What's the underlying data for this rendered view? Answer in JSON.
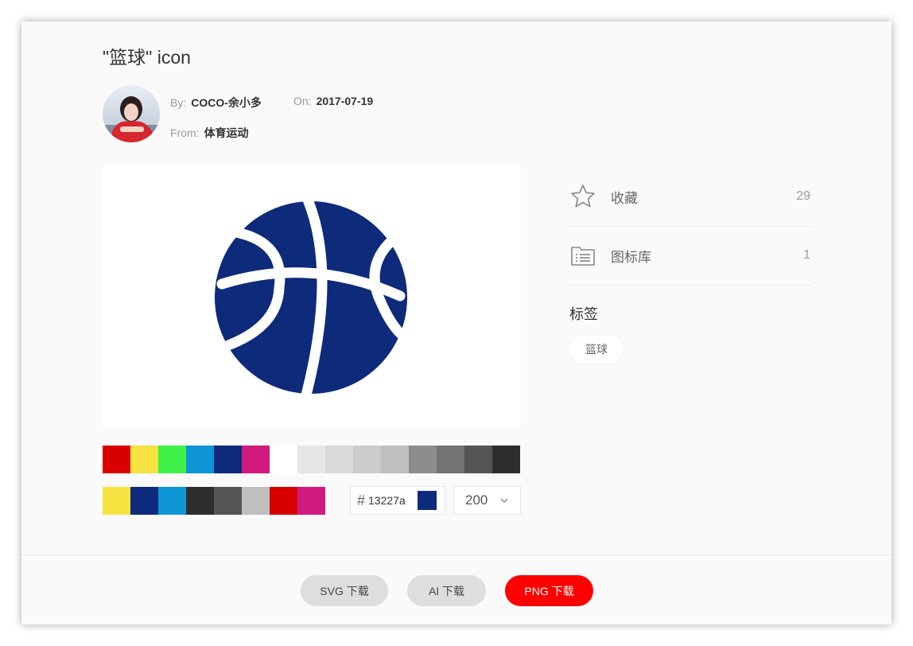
{
  "title": "\"篮球\" icon",
  "meta": {
    "by_label": "By:",
    "author": "COCO-余小多",
    "on_label": "On:",
    "date": "2017-07-19",
    "from_label": "From:",
    "collection": "体育运动"
  },
  "preview": {
    "icon": "basketball-icon",
    "color": "#0e2a7a"
  },
  "palette_row1": [
    "#d90000",
    "#f5e342",
    "#3ef24a",
    "#0f96d6",
    "#0e2a7a",
    "#d11a7f",
    "#ffffff",
    "#e6e6e6",
    "#d9d9d9",
    "#cccccc",
    "#bfbfbf",
    "#8c8c8c",
    "#737373",
    "#555555",
    "#2e2e2e"
  ],
  "palette_row2": [
    "#f5e342",
    "#0e2a7a",
    "#0f96d6",
    "#2e2e2e",
    "#555555",
    "#bfbfbf",
    "#d90000",
    "#d11a7f"
  ],
  "color_input": {
    "hash": "#",
    "value": "13227a",
    "swatch": "#0e2a7a"
  },
  "size_select": {
    "value": "200"
  },
  "sidebar": {
    "favorite": {
      "icon": "star-icon",
      "label": "收藏",
      "count": "29"
    },
    "library": {
      "icon": "folder-list-icon",
      "label": "图标库",
      "count": "1"
    },
    "tags_title": "标签",
    "tags": [
      "篮球"
    ]
  },
  "footer": {
    "svg_button": "SVG 下载",
    "ai_button": "AI 下载",
    "png_button": "PNG 下载"
  }
}
